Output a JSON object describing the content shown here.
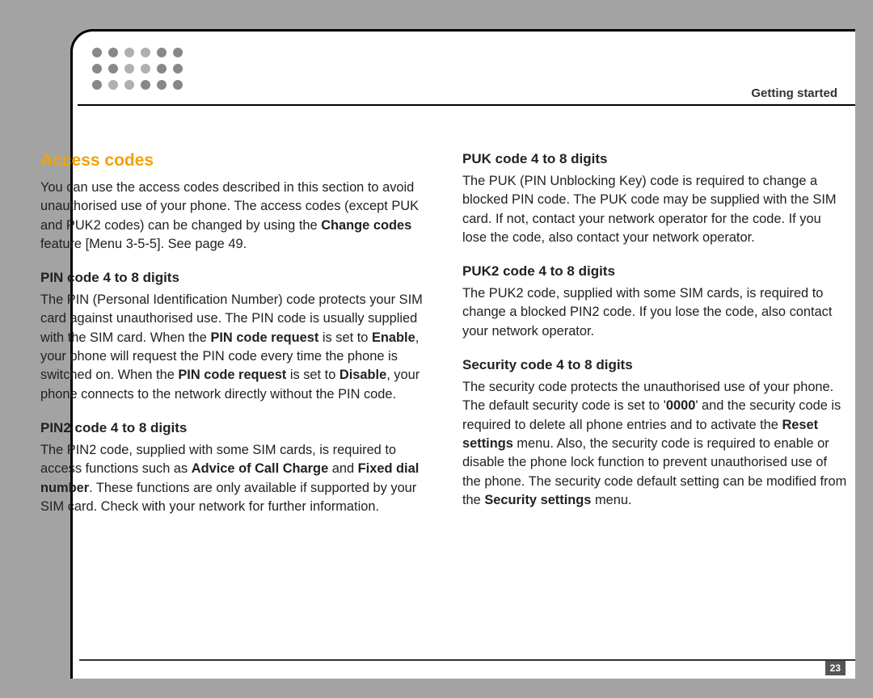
{
  "header": {
    "section": "Getting started"
  },
  "title": "Access codes",
  "intro": {
    "p1a": "You can use the access codes described in this section to avoid unauthorised use of your phone. The access codes (except PUK and PUK2 codes) can be changed by using the ",
    "p1b": "Change codes",
    "p1c": " feature [Menu 3-5-5]. See page 49."
  },
  "pin": {
    "h": "PIN code 4 to 8 digits",
    "a": "The PIN (Personal Identification Number) code protects your SIM card against unauthorised use. The PIN code is usually supplied with the SIM card. When the ",
    "b": "PIN code request",
    "c": " is set to ",
    "d": "Enable",
    "e": ", your phone will request the PIN code every time the phone is switched on. When the ",
    "f": "PIN code request",
    "g": " is set to ",
    "h2": "Disable",
    "i": ", your phone connects to the network directly without the PIN code."
  },
  "pin2": {
    "h": "PIN2 code 4 to 8 digits",
    "a": "The PIN2 code, supplied with some SIM cards, is required to access functions such as ",
    "b": "Advice of Call Charge",
    "c": " and ",
    "d": "Fixed dial number",
    "e": ". These functions are only available if supported by your SIM card. Check with your network for further information."
  },
  "puk": {
    "h": "PUK code 4 to 8 digits",
    "a": "The PUK (PIN Unblocking Key) code is required to change a blocked PIN code. The PUK code may be supplied with the SIM card. If not, contact your network operator for the code. If you lose the code, also contact your network operator."
  },
  "puk2": {
    "h": "PUK2 code 4 to 8 digits",
    "a": "The PUK2 code, supplied with some SIM cards, is required to change a blocked PIN2 code. If you lose the code, also contact your network operator."
  },
  "sec": {
    "h": "Security code 4 to 8 digits",
    "a": "The security code protects the unauthorised use of your phone. The default security code is set to '",
    "b": "0000",
    "c": "' and the security code is required to delete all phone entries and to activate the ",
    "d": "Reset settings",
    "e": " menu. Also, the security code is required to enable or disable the phone lock function to prevent unauthorised use of the phone. The security code default setting can be modified from the ",
    "f": "Security settings",
    "g": " menu."
  },
  "page_number": "23"
}
